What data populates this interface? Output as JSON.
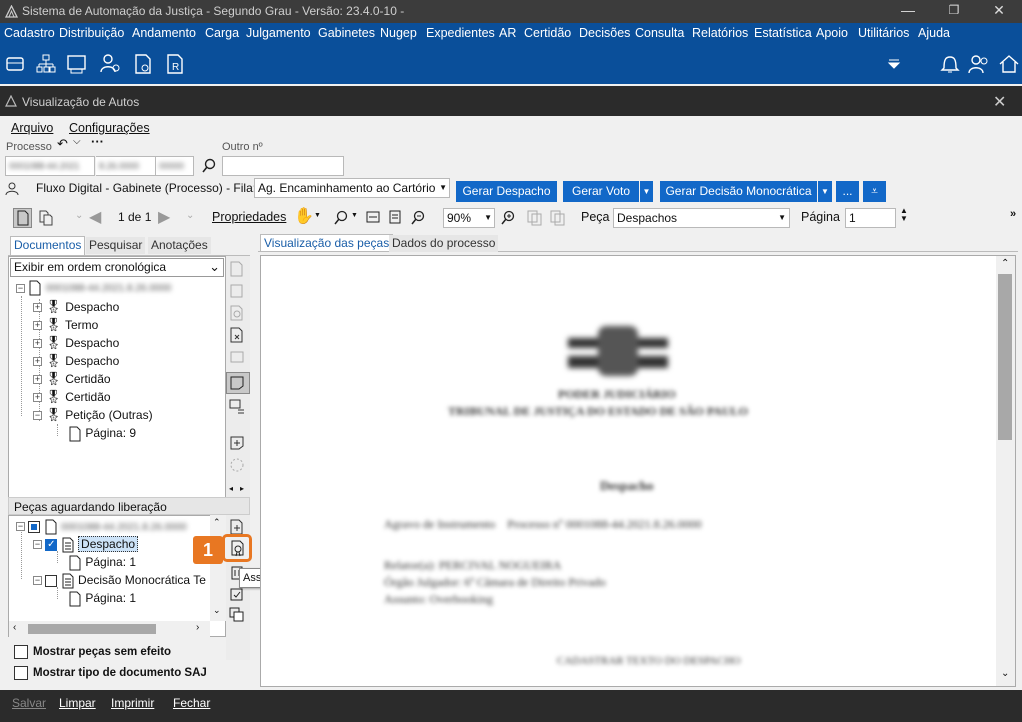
{
  "titlebar": {
    "title": "Sistema de Automação da Justiça - Segundo Grau - Versão: 23.4.0-10 -",
    "minimize": "—",
    "restore": "❐",
    "close": "✕"
  },
  "menu": [
    "Cadastro",
    "Distribuição",
    "Andamento",
    "Carga",
    "Julgamento",
    "Gabinetes",
    "Nugep",
    "Expedientes",
    "AR",
    "Certidão",
    "Decisões",
    "Consulta",
    "Relatórios",
    "Estatística",
    "Apoio",
    "Utilitários",
    "Ajuda"
  ],
  "subwindow": {
    "title": "Visualização de Autos",
    "close": "✕"
  },
  "file_menu": {
    "arquivo": "Arquivo",
    "configuracoes": "Configurações"
  },
  "processo": {
    "label": "Processo",
    "value1": "0001088-44.2021",
    "value2": "8.26.0000",
    "value3": "00000",
    "outro_label": "Outro nº",
    "outro_value": ""
  },
  "fluxo": {
    "label": "Fluxo Digital - Gabinete (Processo) - Fila:",
    "fila": "Ag. Encaminhamento ao Cartório",
    "btn_despacho": "Gerar Despacho",
    "btn_voto": "Gerar Voto",
    "btn_decisao": "Gerar Decisão Monocrática",
    "btn_more": "..."
  },
  "toolbar": {
    "page_of": "1 de 1",
    "propriedades": "Propriedades",
    "zoom": "90%",
    "peca_label": "Peça",
    "peca_value": "Despachos",
    "pagina_label": "Página",
    "pagina_value": "1"
  },
  "left_tabs": {
    "documentos": "Documentos",
    "pesquisar": "Pesquisar",
    "anotacoes": "Anotações"
  },
  "ordem": "Exibir em ordem cronológica",
  "tree": {
    "root": "0001088-44.2021.8.26.0000",
    "items": [
      "Despacho",
      "Termo",
      "Despacho",
      "Despacho",
      "Certidão",
      "Certidão",
      "Petição (Outras)"
    ],
    "sub": "Página: 9"
  },
  "pecas": {
    "header": "Peças aguardando liberação",
    "root": "0001088-44.2021.8.26.0000",
    "item1": "Despacho",
    "item1_page": "Página: 1",
    "item2": "Decisão Monocrática Te",
    "item2_page": "Página: 1"
  },
  "tooltip": "Assinar documentos",
  "step_badge": "1",
  "checkboxes": {
    "sem_efeito": "Mostrar peças sem efeito",
    "tipo_doc": "Mostrar tipo de documento SAJ"
  },
  "right_tabs": {
    "visualizacao": "Visualização das peças",
    "dados": "Dados do processo"
  },
  "document": {
    "header1": "PODER JUDICIÁRIO",
    "header2": "TRIBUNAL DE JUSTIÇA DO ESTADO DE SÃO PAULO",
    "title": "Despacho",
    "line1": "Agravo de Instrumento    Processo nº 0001088-44.2021.8.26.0000",
    "line2": "Relator(a): PERCIVAL NOGUEIRA",
    "line3": "Órgão Julgador: 6ª Câmara de Direito Privado",
    "line4": "Assunto: Overbooking",
    "line5": "CADASTRAR TEXTO DO DESPACHO"
  },
  "status": {
    "salvar": "Salvar",
    "limpar": "Limpar",
    "imprimir": "Imprimir",
    "fechar": "Fechar"
  },
  "colors": {
    "menu_bg": "#0a4f9a",
    "titlebar": "#3c3c3c",
    "button": "#1268c8",
    "badge": "#e87722"
  }
}
